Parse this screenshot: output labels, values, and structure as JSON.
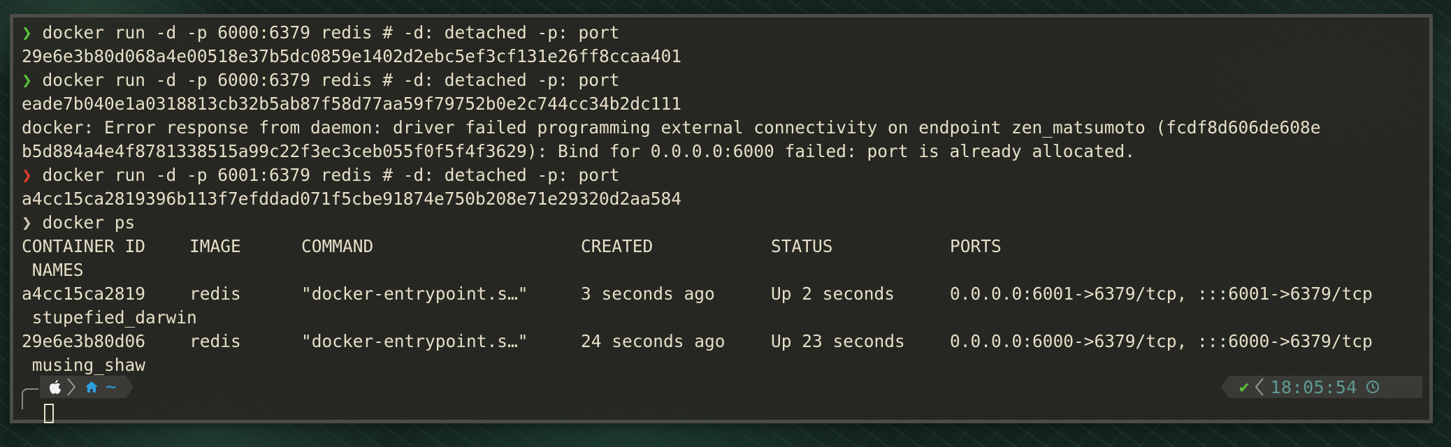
{
  "terminal": {
    "lines": [
      {
        "prompt": "❯",
        "text": " docker run -d -p 6000:6379 redis # -d: detached -p: port"
      },
      {
        "text": "29e6e3b80d068a4e00518e37b5dc0859e1402d2ebc5ef3cf131e26ff8ccaa401"
      },
      {
        "prompt": "❯",
        "text": " docker run -d -p 6000:6379 redis # -d: detached -p: port"
      },
      {
        "text": "eade7b040e1a0318813cb32b5ab87f58d77aa59f79752b0e2c744cc34b2dc111"
      },
      {
        "text": "docker: Error response from daemon: driver failed programming external connectivity on endpoint zen_matsumoto (fcdf8d606de608e"
      },
      {
        "text": "b5d884a4e4f8781338515a99c22f3ec3ceb055f0f5f4f3629): Bind for 0.0.0.0:6000 failed: port is already allocated."
      },
      {
        "prompt": "❯",
        "text": " docker run -d -p 6001:6379 redis # -d: detached -p: port"
      },
      {
        "text": "a4cc15ca2819396b113f7efddad071f5cbe91874e750b208e71e29320d2aa584"
      },
      {
        "prompt": "❯",
        "text": " docker ps"
      }
    ],
    "ps_table": {
      "headers": [
        "CONTAINER ID",
        "IMAGE",
        "COMMAND",
        "CREATED",
        "STATUS",
        "PORTS"
      ],
      "names_header": " NAMES",
      "rows": [
        {
          "cells": [
            "a4cc15ca2819",
            "redis",
            "\"docker-entrypoint.s…\"",
            "3 seconds ago",
            "Up 2 seconds",
            "0.0.0.0:6001->6379/tcp, :::6001->6379/tcp"
          ],
          "name": " stupefied_darwin"
        },
        {
          "cells": [
            "29e6e3b80d06",
            "redis",
            "\"docker-entrypoint.s…\"",
            "24 seconds ago",
            "Up 23 seconds",
            "0.0.0.0:6000->6379/tcp, :::6000->6379/tcp"
          ],
          "name": " musing_shaw"
        }
      ]
    },
    "prompt_bar": {
      "left_icons": [
        "apple-icon",
        "home-icon"
      ],
      "directory": "~",
      "status_icon": "check-icon",
      "status_symbol": "✔",
      "time": "18:05:54",
      "clock_icon": "clock-icon"
    },
    "colors": {
      "text": "#e6dfc8",
      "prompt_ok": "#58c23a",
      "prompt_error": "#e23d2c",
      "directory": "#2f9fdc",
      "time": "#5f9c95"
    }
  }
}
